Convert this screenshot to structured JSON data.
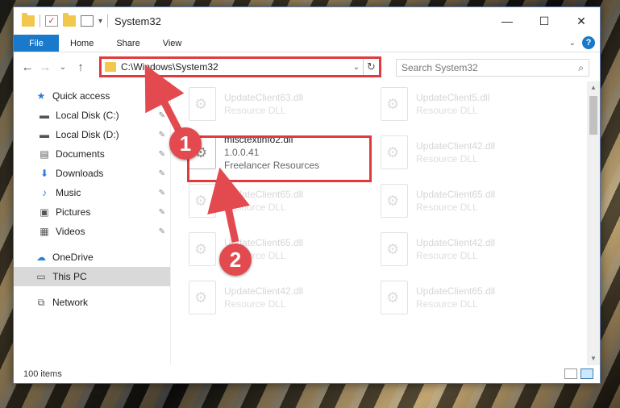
{
  "window": {
    "title": "System32",
    "controls": {
      "minimize": "—",
      "maximize": "☐",
      "close": "✕"
    }
  },
  "ribbon": {
    "tabs": [
      "File",
      "Home",
      "Share",
      "View"
    ],
    "help": "?",
    "collapse": "⌄"
  },
  "nav": {
    "back": "←",
    "forward": "→",
    "recent": "⌄",
    "up": "↑",
    "address": "C:\\Windows\\System32",
    "address_dropdown": "⌄",
    "refresh": "↻",
    "search_placeholder": "Search System32",
    "search_icon": "🔍"
  },
  "sidebar": {
    "items": [
      {
        "label": "Quick access",
        "icon": "star-icon",
        "glyph": "★",
        "pinned": false
      },
      {
        "label": "Local Disk (C:)",
        "icon": "drive-icon",
        "glyph": "▬",
        "pinned": true
      },
      {
        "label": "Local Disk (D:)",
        "icon": "drive-icon",
        "glyph": "▬",
        "pinned": true
      },
      {
        "label": "Documents",
        "icon": "documents-icon",
        "glyph": "▤",
        "pinned": true
      },
      {
        "label": "Downloads",
        "icon": "download-icon",
        "glyph": "⬇",
        "pinned": true
      },
      {
        "label": "Music",
        "icon": "music-icon",
        "glyph": "♪",
        "pinned": true
      },
      {
        "label": "Pictures",
        "icon": "pictures-icon",
        "glyph": "▣",
        "pinned": true
      },
      {
        "label": "Videos",
        "icon": "videos-icon",
        "glyph": "▦",
        "pinned": true
      },
      {
        "label": "OneDrive",
        "icon": "cloud-icon",
        "glyph": "☁",
        "pinned": false
      },
      {
        "label": "This PC",
        "icon": "computer-icon",
        "glyph": "▭",
        "pinned": false
      },
      {
        "label": "Network",
        "icon": "network-icon",
        "glyph": "⧉",
        "pinned": false
      }
    ],
    "pin_glyph": "📌"
  },
  "files": {
    "highlighted": {
      "name": "misctextinfo2.dll",
      "version": "1.0.0.41",
      "company": "Freelancer Resources"
    },
    "faded": [
      {
        "name": "UpdateClient63.dll",
        "sub": "Resource DLL"
      },
      {
        "name": "UpdateClient5.dll",
        "sub": "Resource DLL"
      },
      {
        "name": "UpdateClient42.dll",
        "sub": "Resource DLL"
      },
      {
        "name": "UpdateClient65.dll",
        "sub": "Resource DLL"
      },
      {
        "name": "UpdateClient65.dll",
        "sub": "Resource DLL"
      },
      {
        "name": "UpdateClient65.dll",
        "sub": "Resource DLL"
      },
      {
        "name": "UpdateClient42.dll",
        "sub": "Resource DLL"
      },
      {
        "name": "UpdateClient42.dll",
        "sub": "Resource DLL"
      },
      {
        "name": "UpdateClient65.dll",
        "sub": "Resource DLL"
      }
    ]
  },
  "status": {
    "count": "100 items"
  },
  "annotations": {
    "badge1": "1",
    "badge2": "2",
    "accent": "#e0393e"
  }
}
